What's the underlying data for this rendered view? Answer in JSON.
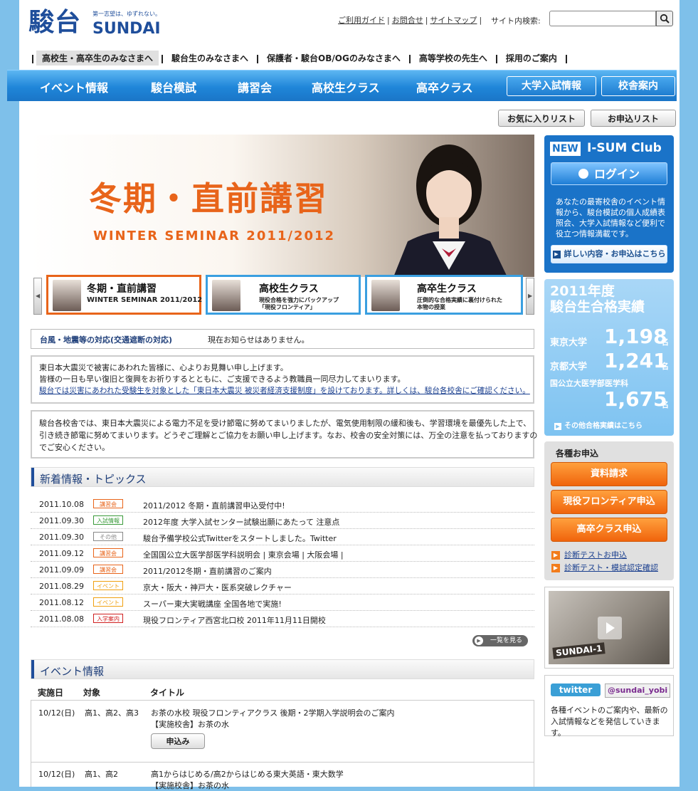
{
  "brand": {
    "logo_kanji": "駿台",
    "logo_english": "SUNDAI",
    "tagline": "第一志望は、ゆずれない。"
  },
  "utility": {
    "links": [
      "ご利用ガイド",
      "お問合せ",
      "サイトマップ"
    ],
    "search_label": "サイト内検索:",
    "search_value": ""
  },
  "audience_nav": [
    "高校生・高卒生のみなさまへ",
    "駿台生のみなさまへ",
    "保護者・駿台OB/OGのみなさまへ",
    "高等学校の先生へ",
    "採用のご案内"
  ],
  "main_nav": {
    "items": [
      "イベント情報",
      "駿台模試",
      "講習会",
      "高校生クラス",
      "高卒クラス"
    ],
    "boxed": [
      "大学入試情報",
      "校舎案内"
    ]
  },
  "actions": {
    "favorites": "お気に入りリスト",
    "applications": "お申込リスト"
  },
  "hero": {
    "title": "冬期・直前講習",
    "subtitle": "WINTER SEMINAR 2011/2012"
  },
  "carousel": [
    {
      "title": "冬期・直前講習",
      "sub": "WINTER SEMINAR 2011/2012"
    },
    {
      "title": "高校生クラス",
      "sub1": "現役合格を強力にバックアップ",
      "sub2": "「現役フロンティア」"
    },
    {
      "title": "高卒生クラス",
      "sub1": "圧倒的な合格実績に裏付けられた",
      "sub2": "本物の授業"
    }
  ],
  "notices": {
    "typhoon_label": "台風・地震等の対応(交通遮断の対応)",
    "typhoon_text": "現在お知らせはありません。",
    "quake_line1": "東日本大震災で被害にあわれた皆様に、心よりお見舞い申し上げます。",
    "quake_line2": "皆様の一日も早い復旧と復興をお祈りするとともに、ご支援できるよう教職員一同尽力してまいります。",
    "quake_link": "駿台では災害にあわれた受験生を対象とした「東日本大震災 被災者経済支援制度」を設けております。詳しくは、駿台各校舎にご確認ください。",
    "power_line1": "駿台各校舎では、東日本大震災による電力不足を受け節電に努めてまいりましたが、電気使用制限の緩和後も、学習環境を最優先した上で、",
    "power_line2": "引き続き節電に努めてまいります。どうぞご理解とご協力をお願い申し上げます。なお、校舎の安全対策には、万全の注意を払っておりますの",
    "power_line3": "でご安心ください。"
  },
  "news": {
    "title": "新着情報・トピックス",
    "more": "一覧を見る",
    "items": [
      {
        "date": "2011.10.08",
        "tag": "講習会",
        "color": "#e8641a",
        "title": "2011/2012 冬期・直前講習申込受付中!"
      },
      {
        "date": "2011.09.30",
        "tag": "入試情報",
        "color": "#3a9a3a",
        "title": "2012年度 大学入試センター試験出願にあたって 注意点"
      },
      {
        "date": "2011.09.30",
        "tag": "その他",
        "color": "#888888",
        "title": "駿台予備学校公式Twitterをスタートしました。Twitter"
      },
      {
        "date": "2011.09.12",
        "tag": "講習会",
        "color": "#e8641a",
        "title": "全国国公立大医学部医学科説明会 | 東京会場 | 大阪会場 |"
      },
      {
        "date": "2011.09.09",
        "tag": "講習会",
        "color": "#e8641a",
        "title": "2011/2012冬期・直前講習のご案内"
      },
      {
        "date": "2011.08.29",
        "tag": "イベント",
        "color": "#f0a010",
        "title": "京大・阪大・神戸大・医系突破レクチャー"
      },
      {
        "date": "2011.08.12",
        "tag": "イベント",
        "color": "#f0a010",
        "title": "スーパー東大実戦講座 全国各地で実施!"
      },
      {
        "date": "2011.08.08",
        "tag": "入学案内",
        "color": "#d02020",
        "title": "現役フロンティア西宮北口校 2011年11月11日開校"
      }
    ]
  },
  "events": {
    "title": "イベント情報",
    "headers": [
      "実施日",
      "対象",
      "タイトル"
    ],
    "rows": [
      {
        "date": "10/12(日)",
        "target": "高1、高2、高3",
        "title": "お茶の水校 現役フロンティアクラス 後期・2学期入学説明会のご案内",
        "place": "【実施校舎】お茶の水",
        "button": "申込み"
      },
      {
        "date": "10/12(日)",
        "target": "高1、高2",
        "title": "高1からはじめる/高2からはじめる東大英語・東大数学",
        "place": "【実施校舎】お茶の水"
      }
    ]
  },
  "isum": {
    "new": "NEW",
    "club": "I-SUM Club",
    "login": "ログイン",
    "desc": "あなたの最寄校舎のイベント情報から、駿台模試の個人成績表照会、大学入試情報など便利で役立つ情報満載です。",
    "detail": "詳しい内容・お申込はこちら"
  },
  "results": {
    "year": "2011年度",
    "heading": "駿台生合格実績",
    "items": [
      {
        "label": "東京大学",
        "num": "1,198",
        "unit": "名"
      },
      {
        "label": "京都大学",
        "num": "1,241",
        "unit": "名"
      },
      {
        "label": "国公立大医学部医学科",
        "num": "1,675",
        "unit": "名"
      }
    ],
    "other": "その他合格実績はこちら"
  },
  "apply": {
    "heading": "各種お申込",
    "buttons": [
      "資料請求",
      "現役フロンティア申込",
      "高卒クラス申込"
    ],
    "links": [
      "診断テストお申込",
      "診断テスト・模試認定確認"
    ]
  },
  "video": {
    "sign": "SUNDAI-1"
  },
  "twitter": {
    "logo": "twitter",
    "handle": "@sundai_yobi",
    "desc": "各種イベントのご案内や、最新の入試情報などを発信していきます。"
  }
}
